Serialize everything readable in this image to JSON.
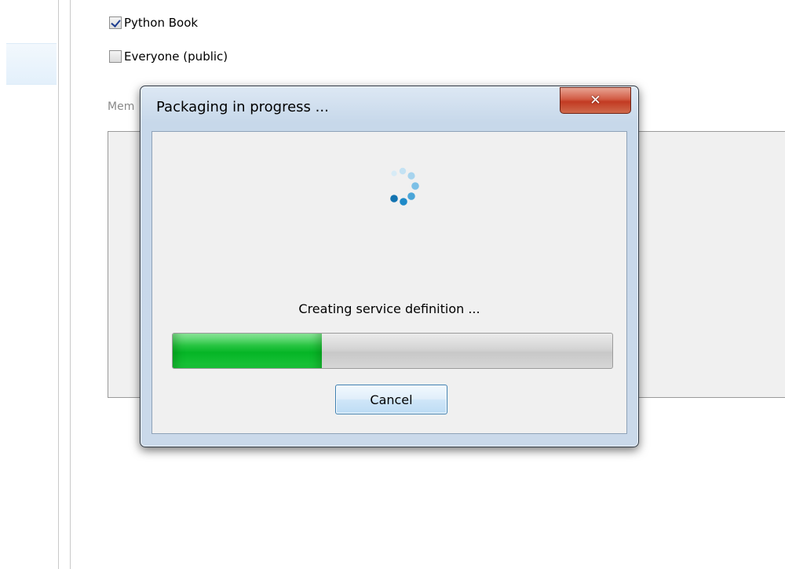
{
  "background": {
    "permissions": [
      {
        "label": "Python Book",
        "checked": true
      },
      {
        "label": "Everyone (public)",
        "checked": false
      }
    ],
    "members_label_visible": "Mem"
  },
  "dialog": {
    "title": "Packaging in progress ...",
    "close_icon": "close-x-icon",
    "status": "Creating service definition ...",
    "progress_fraction": 0.34,
    "progress_color": "#0bbf2c",
    "cancel_label": "Cancel"
  }
}
